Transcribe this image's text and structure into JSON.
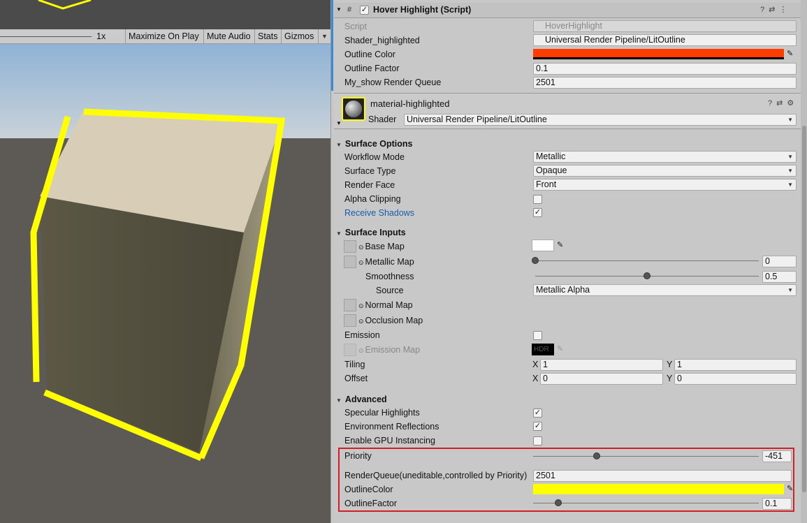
{
  "game_view": {
    "scale": "1x",
    "buttons": [
      "Maximize On Play",
      "Mute Audio",
      "Stats",
      "Gizmos"
    ]
  },
  "hover_component": {
    "title": "Hover Highlight (Script)",
    "enabled": true,
    "fields": {
      "script_label": "Script",
      "script_value": "HoverHighlight",
      "shader_label": "Shader_highlighted",
      "shader_value": "Universal Render Pipeline/LitOutline",
      "color_label": "Outline Color",
      "color_value": "#ff3c00",
      "factor_label": "Outline Factor",
      "factor_value": "0.1",
      "queue_label": "My_show Render Queue",
      "queue_value": "2501"
    }
  },
  "material": {
    "name": "material-highlighted",
    "shader_label": "Shader",
    "shader_value": "Universal Render Pipeline/LitOutline"
  },
  "surface_options": {
    "title": "Surface Options",
    "workflow_label": "Workflow Mode",
    "workflow_value": "Metallic",
    "surface_type_label": "Surface Type",
    "surface_type_value": "Opaque",
    "render_face_label": "Render Face",
    "render_face_value": "Front",
    "alpha_label": "Alpha Clipping",
    "alpha_checked": false,
    "shadows_label": "Receive Shadows",
    "shadows_checked": true
  },
  "surface_inputs": {
    "title": "Surface Inputs",
    "base_map_label": "Base Map",
    "metallic_label": "Metallic Map",
    "metallic_value": "0",
    "metallic_fraction": 0,
    "smoothness_label": "Smoothness",
    "smoothness_value": "0.5",
    "smoothness_fraction": 0.5,
    "source_label": "Source",
    "source_value": "Metallic Alpha",
    "normal_label": "Normal Map",
    "occlusion_label": "Occlusion Map",
    "emission_label": "Emission",
    "emission_checked": false,
    "emission_map_label": "Emission Map",
    "hdr_label": "HDR",
    "tiling_label": "Tiling",
    "tiling_x": "1",
    "tiling_y": "1",
    "offset_label": "Offset",
    "offset_x": "0",
    "offset_y": "0",
    "x_label": "X",
    "y_label": "Y"
  },
  "advanced": {
    "title": "Advanced",
    "specular_label": "Specular Highlights",
    "specular_checked": true,
    "env_label": "Environment Reflections",
    "env_checked": true,
    "gpu_label": "Enable GPU Instancing",
    "gpu_checked": false,
    "priority_label": "Priority",
    "priority_value": "-451",
    "queue_label": "RenderQueue(uneditable,controlled by Priority)",
    "queue_value": "2501",
    "outline_color_label": "OutlineColor",
    "outline_color_value": "#ffff00",
    "outline_factor_label": "OutlineFactor",
    "outline_factor_value": "0.1"
  },
  "colors": {
    "accent_blue": "#1a5ca8",
    "highlight_box": "#d21f26",
    "outline_yellow": "#ffff00"
  }
}
